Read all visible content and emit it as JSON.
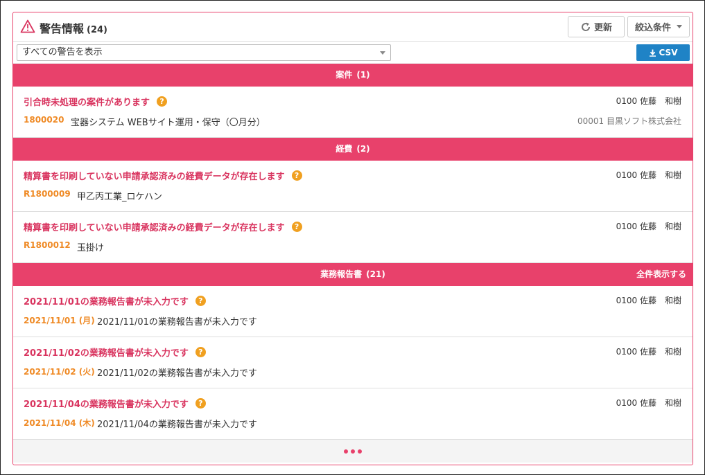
{
  "header": {
    "title": "警告情報",
    "count": "(24)",
    "refresh_label": "更新",
    "filter_label": "絞込条件"
  },
  "toolbar": {
    "select_value": "すべての警告を表示",
    "csv_label": "CSV"
  },
  "sections": [
    {
      "title": "案件",
      "count": "(1)",
      "items": [
        {
          "title": "引合時未処理の案件があります",
          "user": "0100 佐藤　和樹",
          "id": "1800020",
          "desc": "宝器システム WEBサイト運用・保守（〇月分）",
          "client": "00001 目黒ソフト株式会社"
        }
      ]
    },
    {
      "title": "経費",
      "count": "(2)",
      "items": [
        {
          "title": "精算書を印刷していない申請承認済みの経費データが存在します",
          "user": "0100 佐藤　和樹",
          "id": "R1800009",
          "desc": "甲乙丙工業_ロケハン"
        },
        {
          "title": "精算書を印刷していない申請承認済みの経費データが存在します",
          "user": "0100 佐藤　和樹",
          "id": "R1800012",
          "desc": "玉掛け"
        }
      ]
    },
    {
      "title": "業務報告書",
      "count": "(21)",
      "show_all": "全件表示する",
      "items": [
        {
          "title": "2021/11/01の業務報告書が未入力です",
          "user": "0100 佐藤　和樹",
          "id": "2021/11/01 (月)",
          "desc": "2021/11/01の業務報告書が未入力です"
        },
        {
          "title": "2021/11/02の業務報告書が未入力です",
          "user": "0100 佐藤　和樹",
          "id": "2021/11/02 (火)",
          "desc": "2021/11/02の業務報告書が未入力です"
        },
        {
          "title": "2021/11/04の業務報告書が未入力です",
          "user": "0100 佐藤　和樹",
          "id": "2021/11/04 (木)",
          "desc": "2021/11/04の業務報告書が未入力です"
        }
      ]
    }
  ],
  "help_icon_glyph": "?",
  "colors": {
    "accent": "#e8416b",
    "id_orange": "#ef8a25",
    "help_orange": "#f0a020",
    "csv_blue": "#1f83c6"
  }
}
